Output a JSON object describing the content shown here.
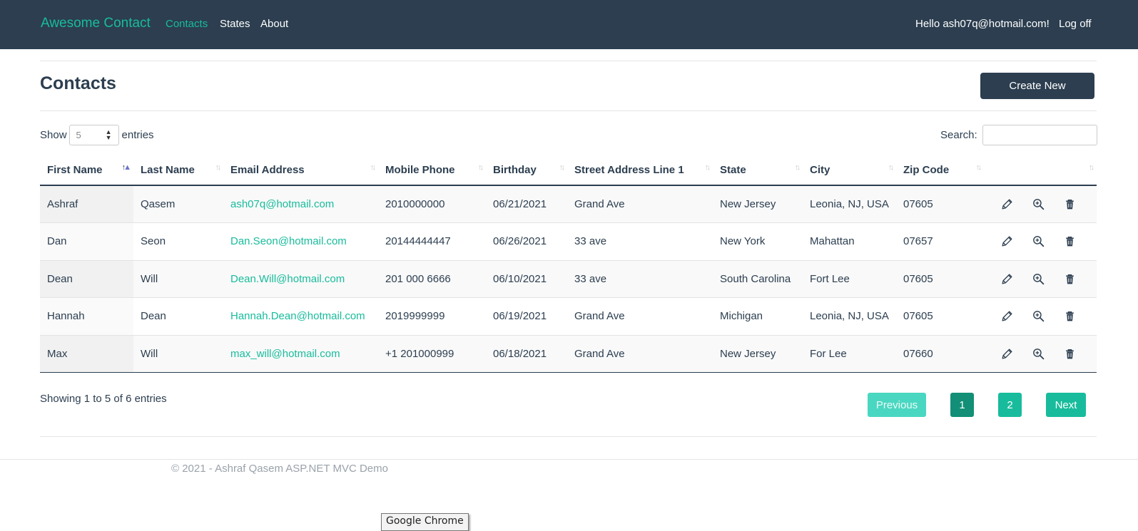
{
  "navbar": {
    "brand": "Awesome Contact",
    "links": [
      "Contacts",
      "States",
      "About"
    ],
    "greeting": "Hello ash07q@hotmail.com!",
    "logoff": "Log off"
  },
  "page": {
    "title": "Contacts",
    "create_label": "Create New"
  },
  "controls": {
    "show_label": "Show",
    "entries_label": "entries",
    "page_length": "5",
    "search_label": "Search:",
    "search_value": ""
  },
  "table": {
    "columns": [
      "First Name",
      "Last Name",
      "Email Address",
      "Mobile Phone",
      "Birthday",
      "Street Address Line 1",
      "State",
      "City",
      "Zip Code",
      ""
    ],
    "sorted_column": "First Name",
    "sort_direction": "ascending",
    "rows": [
      [
        "Ashraf",
        "Qasem",
        "ash07q@hotmail.com",
        "2010000000",
        "06/21/2021",
        "Grand Ave",
        "New Jersey",
        "Leonia, NJ, USA",
        "07605"
      ],
      [
        "Dan",
        "Seon",
        "Dan.Seon@hotmail.com",
        "20144444447",
        "06/26/2021",
        "33 ave",
        "New York",
        "Mahattan",
        "07657"
      ],
      [
        "Dean",
        "Will",
        "Dean.Will@hotmail.com",
        "201 000 6666",
        "06/10/2021",
        "33 ave",
        "South Carolina",
        "Fort Lee",
        "07605"
      ],
      [
        "Hannah",
        "Dean",
        "Hannah.Dean@hotmail.com",
        "2019999999",
        "06/19/2021",
        "Grand Ave",
        "Michigan",
        "Leonia, NJ, USA",
        "07605"
      ],
      [
        "Max",
        "Will",
        "max_will@hotmail.com",
        "+1 201000999",
        "06/18/2021",
        "Grand Ave",
        "New Jersey",
        "For Lee",
        "07660"
      ]
    ],
    "row_actions": [
      "pencil-icon",
      "zoom-in-icon",
      "trash-icon"
    ]
  },
  "info": "Showing 1 to 5 of 6 entries",
  "pagination": {
    "previous": "Previous",
    "pages": [
      "1",
      "2"
    ],
    "current_page": "1",
    "next": "Next"
  },
  "footer": "© 2021 - Ashraf Qasem ASP.NET MVC Demo",
  "tooltip": "Google Chrome",
  "colors": {
    "navbar_bg": "#2c3e50",
    "accent": "#18bc9c",
    "active_page": "#128f76",
    "disabled_previous": "#4ad7c1"
  }
}
